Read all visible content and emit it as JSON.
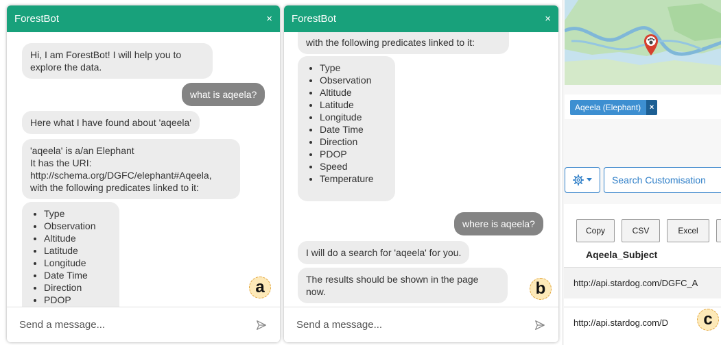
{
  "panel_a": {
    "title": "ForestBot",
    "close_label": "×",
    "messages": {
      "greeting": "Hi, I am ForestBot! I will help you to explore the data.",
      "user_question": "what is aqeela?",
      "found": "Here what I have found about 'aqeela'",
      "desc_line1": "'aqeela' is a/an Elephant",
      "desc_line2": "It has the URI:",
      "desc_line3": "http://schema.org/DGFC/elephant#Aqeela,",
      "desc_line4": "with the following predicates linked to it:",
      "predicates": [
        "Type",
        "Observation",
        "Altitude",
        "Latitude",
        "Longitude",
        "Date Time",
        "Direction",
        "PDOP"
      ]
    },
    "input_placeholder": "Send a message...",
    "marker": "a"
  },
  "panel_b": {
    "title": "ForestBot",
    "close_label": "×",
    "messages": {
      "cont_line": "with the following predicates linked to it:",
      "predicates": [
        "Type",
        "Observation",
        "Altitude",
        "Latitude",
        "Longitude",
        "Date Time",
        "Direction",
        "PDOP",
        "Speed",
        "Temperature"
      ],
      "user_question": "where is aqeela?",
      "search_reply": "I will do a search for 'aqeela' for you.",
      "results_reply": "The results should be shown in the page now."
    },
    "input_placeholder": "Send a message...",
    "marker": "b"
  },
  "panel_c": {
    "tag_label": "Aqeela (Elephant)",
    "tag_close": "×",
    "search_customisation": "Search Customisation",
    "buttons": [
      "Copy",
      "CSV",
      "Excel"
    ],
    "column_header": "Aqeela_Subject",
    "rows": [
      "http://api.stardog.com/DGFC_A",
      "http://api.stardog.com/D"
    ],
    "marker": "c"
  },
  "colors": {
    "header": "#18a17b",
    "user_bubble": "#848484",
    "bot_bubble": "#ececec",
    "accent_blue": "#2f7fc8",
    "marker_fill": "#fde9b8"
  }
}
